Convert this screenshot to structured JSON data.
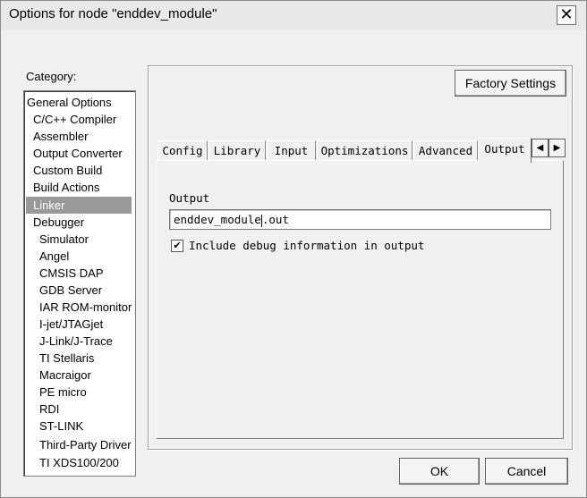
{
  "window": {
    "title": "Options for node \"enddev_module\"",
    "close_label": "✕"
  },
  "category": {
    "label": "Category:",
    "selected": "Linker",
    "items": [
      {
        "label": "General Options"
      },
      {
        "label": "C/C++ Compiler"
      },
      {
        "label": "Assembler"
      },
      {
        "label": "Output Converter"
      },
      {
        "label": "Custom Build"
      },
      {
        "label": "Build Actions"
      },
      {
        "label": "Linker"
      },
      {
        "label": "Debugger"
      },
      {
        "label": "Simulator"
      },
      {
        "label": "Angel"
      },
      {
        "label": "CMSIS DAP"
      },
      {
        "label": "GDB Server"
      },
      {
        "label": "IAR ROM-monitor"
      },
      {
        "label": "I-jet/JTAGjet"
      },
      {
        "label": "J-Link/J-Trace"
      },
      {
        "label": "TI Stellaris"
      },
      {
        "label": "Macraigor"
      },
      {
        "label": "PE micro"
      },
      {
        "label": "RDI"
      },
      {
        "label": "ST-LINK"
      },
      {
        "label": "Third-Party Driver"
      },
      {
        "label": "TI XDS100/200"
      }
    ]
  },
  "factory_settings_label": "Factory Settings",
  "tabs": [
    {
      "label": "Config"
    },
    {
      "label": "Library"
    },
    {
      "label": "Input"
    },
    {
      "label": "Optimizations"
    },
    {
      "label": "Advanced"
    },
    {
      "label": "Output"
    }
  ],
  "active_tab": "Output",
  "tab_scroll": {
    "left_icon": "arrow-left-icon",
    "right_icon": "arrow-right-icon",
    "left": "◀",
    "right": "▶"
  },
  "output": {
    "group_label": "Output",
    "filename_before_caret": "enddev_module",
    "filename_after_caret": ".out",
    "include_debug_checked": true,
    "check_mark": "✔",
    "include_debug_label": "Include debug information in output"
  },
  "buttons": {
    "ok_label": "OK",
    "cancel_label": "Cancel"
  },
  "colors": {
    "selected_background": "#999999",
    "dialog_background": "#f0f0f0"
  }
}
